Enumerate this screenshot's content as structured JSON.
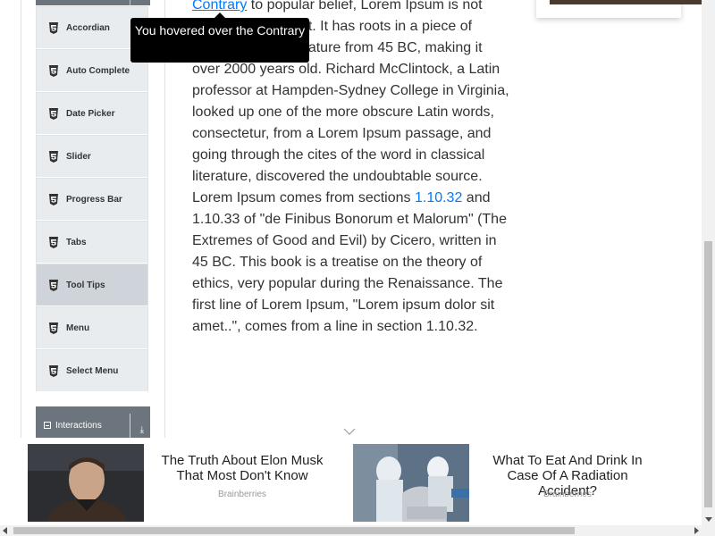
{
  "sidebar": {
    "items": [
      {
        "label": "Accordian",
        "icon": "html5-icon"
      },
      {
        "label": "Auto Complete",
        "icon": "html5-icon"
      },
      {
        "label": "Date Picker",
        "icon": "html5-icon"
      },
      {
        "label": "Slider",
        "icon": "html5-icon"
      },
      {
        "label": "Progress Bar",
        "icon": "html5-icon"
      },
      {
        "label": "Tabs",
        "icon": "html5-icon"
      },
      {
        "label": "Tool Tips",
        "icon": "html5-icon",
        "active": true
      },
      {
        "label": "Menu",
        "icon": "html5-icon"
      },
      {
        "label": "Select Menu",
        "icon": "html5-icon"
      }
    ],
    "interactions_header": "Interactions"
  },
  "tooltip": {
    "text": "You hovered over the Contrary"
  },
  "content": {
    "link_contrary": "Contrary",
    "text_1": " to popular belief, Lorem Ipsum is not simply random text. It has roots in a piece of classical Latin literature from 45 BC, making it over 2000 years old. Richard McClintock, a Latin professor at Hampden-Sydney College in Virginia, looked up one of the more obscure Latin words, consectetur, from a Lorem Ipsum passage, and going through the cites of the word in classical literature, discovered the undoubtable source. Lorem Ipsum comes from sections ",
    "link_section": "1.10.32",
    "text_2": " and 1.10.33 of \"de Finibus Bonorum et Malorum\" (The Extremes of Good and Evil) by Cicero, written in 45 BC. This book is a treatise on the theory of ethics, very popular during the Renaissance. The first line of Lorem Ipsum, \"Lorem ipsum dolor sit amet..\", comes from a line in section 1.10.32."
  },
  "ads": [
    {
      "headline": "The Truth About Elon Musk That Most Don't Know",
      "source": "Brainberries"
    },
    {
      "headline": "What To Eat And Drink In Case Of A Radiation Accident?",
      "source": "Brainberries"
    }
  ],
  "colors": {
    "link": "#007bff",
    "menu_bg": "#e9ecef",
    "menu_active_bg": "#ced4da",
    "header_bg": "#6c757d",
    "tooltip_bg": "#000000"
  }
}
